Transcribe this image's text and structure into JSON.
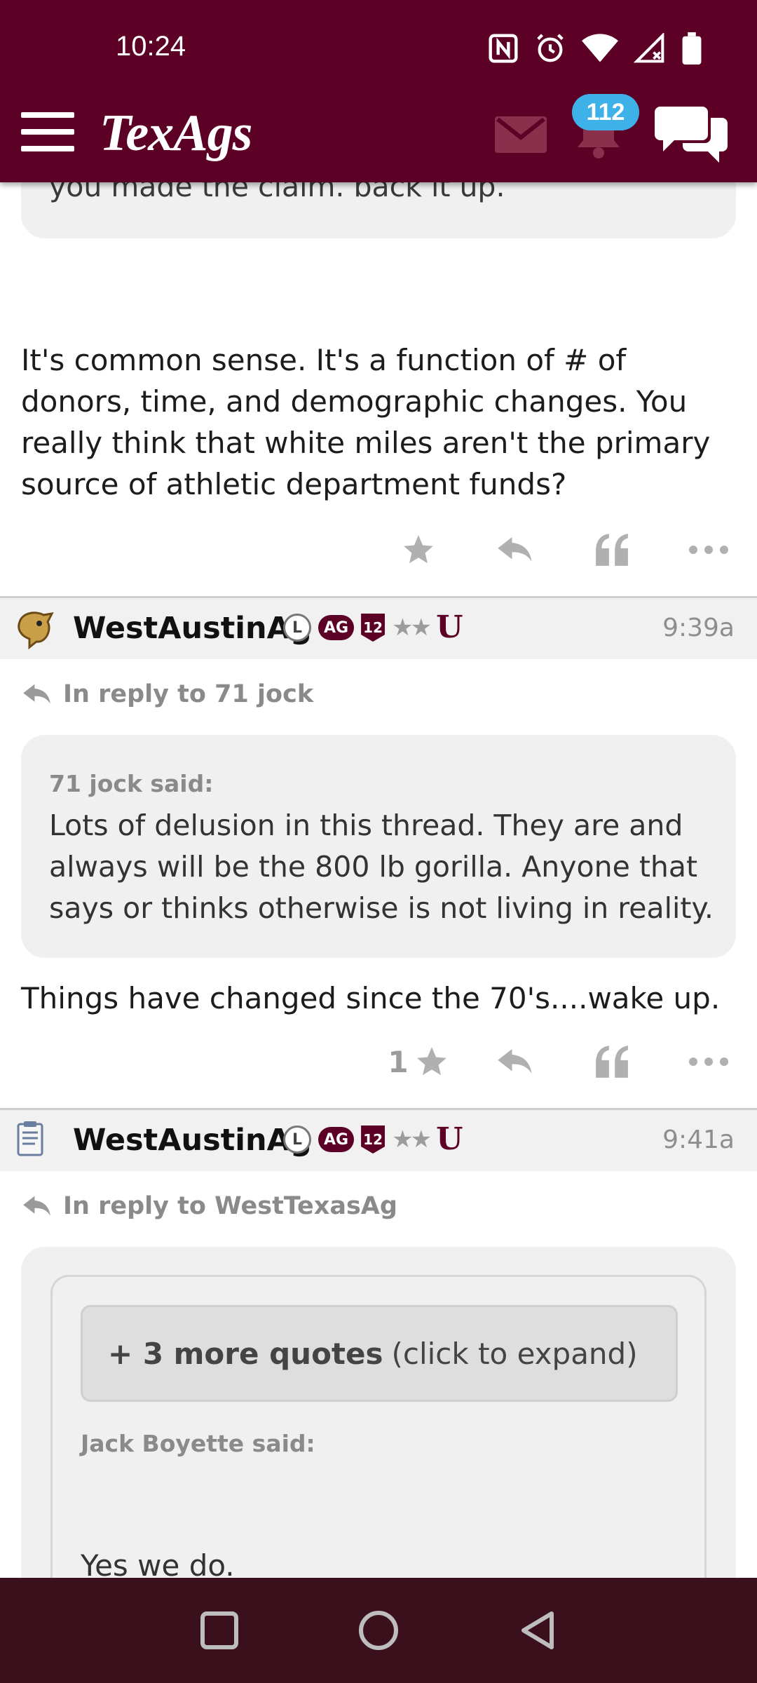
{
  "status_bar": {
    "time": "10:24"
  },
  "header": {
    "logo": "TexAgs",
    "notification_count": "112"
  },
  "previous_quote": {
    "text": "you made the claim. back it up."
  },
  "post1": {
    "body": "It's common sense. It's a function of # of donors, time, and demographic changes. You really think that white miles aren't the primary source of athletic department funds?",
    "star_count": ""
  },
  "post2": {
    "username": "WestAustinAg",
    "badges": {
      "l": "L",
      "ag": "AG",
      "twelve": "12",
      "stars": "★★",
      "u": "U"
    },
    "time": "9:39a",
    "reply_to": "In reply to 71 jock",
    "quote_author": "71 jock said:",
    "quote_text": "Lots of delusion in this thread. They are and always will be the 800 lb gorilla. Anyone that says or thinks otherwise is not living in reality.",
    "body": "Things have changed since the 70's....wake up.",
    "star_count": "1"
  },
  "post3": {
    "username": "WestAustinAg",
    "badges": {
      "l": "L",
      "ag": "AG",
      "twelve": "12",
      "stars": "★★",
      "u": "U"
    },
    "time": "9:41a",
    "reply_to": "In reply to WestTexasAg",
    "more_quotes_bold": "+ 3 more quotes",
    "more_quotes_rest": "(click to expand)",
    "quote_author": "Jack Boyette said:",
    "quote_text": "Yes we do."
  },
  "colors": {
    "brand": "#5d0025",
    "badge": "#3eb2e8",
    "navbar": "#3b101d"
  },
  "icons": [
    "menu-icon",
    "mail-icon",
    "bell-icon",
    "chat-icon",
    "star-icon",
    "reply-icon",
    "quote-icon",
    "more-icon"
  ]
}
